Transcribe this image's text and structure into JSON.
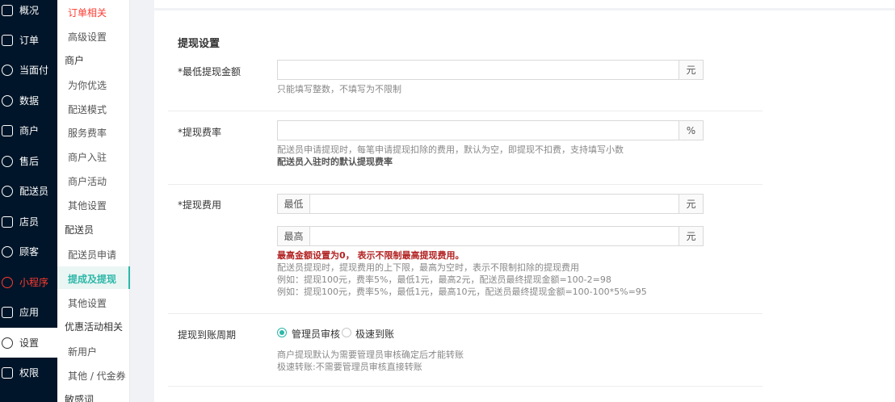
{
  "nav": {
    "items": [
      {
        "label": "概况"
      },
      {
        "label": "订单"
      },
      {
        "label": "当面付"
      },
      {
        "label": "数据"
      },
      {
        "label": "商户"
      },
      {
        "label": "售后"
      },
      {
        "label": "配送员"
      },
      {
        "label": "店员"
      },
      {
        "label": "顾客"
      },
      {
        "label": "小程序"
      },
      {
        "label": "应用"
      },
      {
        "label": "设置"
      },
      {
        "label": "权限"
      }
    ]
  },
  "submenu": {
    "order_related": "订单相关",
    "advanced_settings": "高级设置",
    "merchant_head": "商户",
    "preferred_for_you": "为你优选",
    "delivery_mode": "配送模式",
    "service_rate": "服务费率",
    "merchant_join": "商户入驻",
    "merchant_activity": "商户活动",
    "other_settings_1": "其他设置",
    "courier_head": "配送员",
    "courier_application": "配送员申请",
    "withdraw": "提成及提现",
    "other_settings_2": "其他设置",
    "promo_head": "优惠活动相关",
    "new_user": "新用户",
    "other_coupon": "其他 / 代金券",
    "sensitive_words": "敏感词"
  },
  "form": {
    "section_title": "提现设置",
    "min_amount": {
      "label": "*最低提现金额",
      "unit": "元",
      "value": "",
      "hint": "只能填写整数，不填写为不限制"
    },
    "fee_rate": {
      "label": "*提现费率",
      "unit": "%",
      "value": "",
      "hint1": "配送员申请提现时，每笔申请提现扣除的费用，默认为空，即提现不扣费，支持填写小数",
      "hint2": "配送员入驻时的默认提现费率"
    },
    "fee": {
      "label": "*提现费用",
      "min_prefix": "最低",
      "min_unit": "元",
      "min_value": "",
      "max_prefix": "最高",
      "max_unit": "元",
      "max_value": "",
      "warn": "最高金额设置为0， 表示不限制最高提现费用。",
      "hint1": "配送员提现时，提现费用的上下限，最高为空时，表示不限制扣除的提现费用",
      "hint2": "例如：提现100元，费率5%，最低1元，最高2元，配送员最终提现金额=100-2=98",
      "hint3": "例如：提现100元，费率5%，最低1元，最高10元，配送员最终提现金额=100-100*5%=95"
    },
    "period": {
      "label": "提现到账周期",
      "options": [
        "管理员审核",
        "极速到账"
      ],
      "selected": "管理员审核",
      "hint1": "商户提现默认为需要管理员审核确定后才能转账",
      "hint2": "极速转账:不需要管理员审核直接转账"
    }
  },
  "colors": {
    "sidebar": "#001529",
    "accent": "#2db7a8",
    "danger": "#ff3b30"
  }
}
